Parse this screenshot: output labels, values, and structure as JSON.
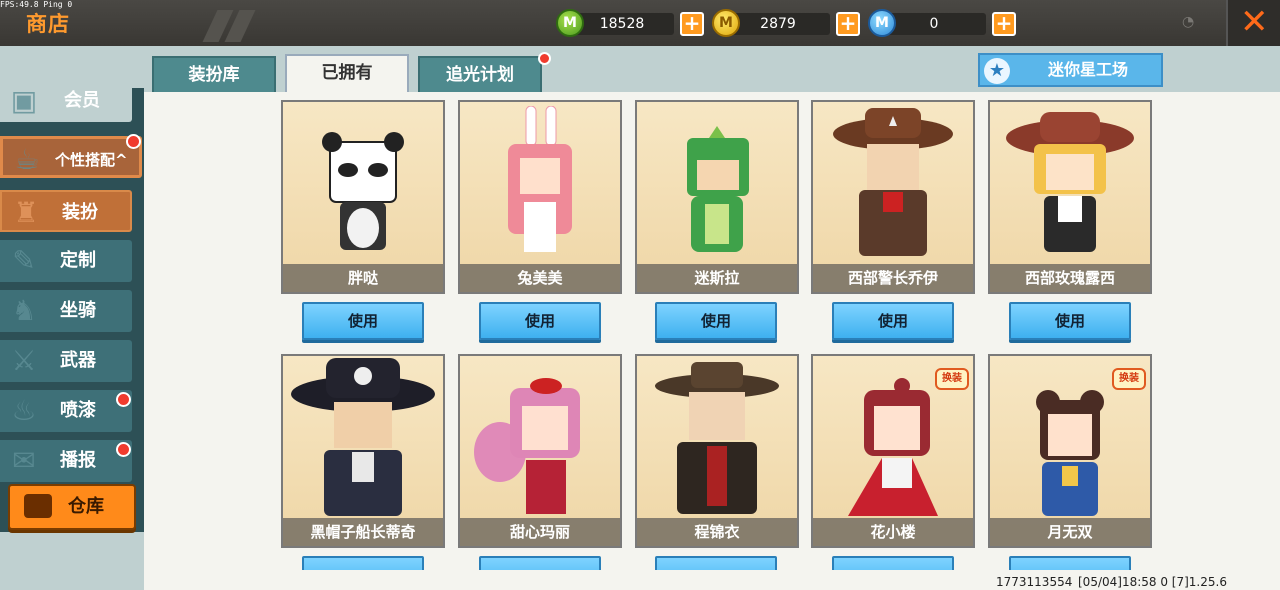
{
  "debug": {
    "fps_text": "FPS:49.8  Ping 0"
  },
  "header": {
    "title": "商店",
    "currencies": [
      {
        "icon": "green-gem-icon",
        "amount": "18528"
      },
      {
        "icon": "gold-coin-icon",
        "amount": "2879"
      },
      {
        "icon": "blue-star-coin-icon",
        "amount": "0"
      }
    ],
    "plus_label": "+",
    "close_label": "✕"
  },
  "sidebar": {
    "items": [
      {
        "label": "会员",
        "icon": "member-icon"
      },
      {
        "label": "个性搭配^",
        "icon": "style-icon"
      },
      {
        "label": "装扮",
        "icon": "outfit-icon"
      },
      {
        "label": "定制",
        "icon": "custom-icon"
      },
      {
        "label": "坐骑",
        "icon": "mount-icon"
      },
      {
        "label": "武器",
        "icon": "weapon-icon"
      },
      {
        "label": "喷漆",
        "icon": "spray-icon"
      },
      {
        "label": "播报",
        "icon": "broadcast-icon"
      }
    ],
    "warehouse_label": "仓库"
  },
  "tabs": [
    {
      "label": "装扮库"
    },
    {
      "label": "已拥有"
    },
    {
      "label": "追光计划"
    }
  ],
  "workshop_label": "迷你星工场",
  "use_label": "使用",
  "badge_label": "换装",
  "cards": [
    {
      "name": "胖哒"
    },
    {
      "name": "兔美美"
    },
    {
      "name": "迷斯拉"
    },
    {
      "name": "西部警长乔伊"
    },
    {
      "name": "西部玫瑰露西"
    },
    {
      "name": "黑帽子船长蒂奇"
    },
    {
      "name": "甜心玛丽"
    },
    {
      "name": "程锦衣"
    },
    {
      "name": "花小楼"
    },
    {
      "name": "月无双"
    }
  ],
  "footer": {
    "uid": "1773113554",
    "version": "[05/04]18:58 0 [7]1.25.6"
  },
  "colors": {
    "accent": "#ff9a1f",
    "tab": "#4e8a8e",
    "use_button": "#3eb0ef",
    "sidebar": "#2d5056"
  }
}
